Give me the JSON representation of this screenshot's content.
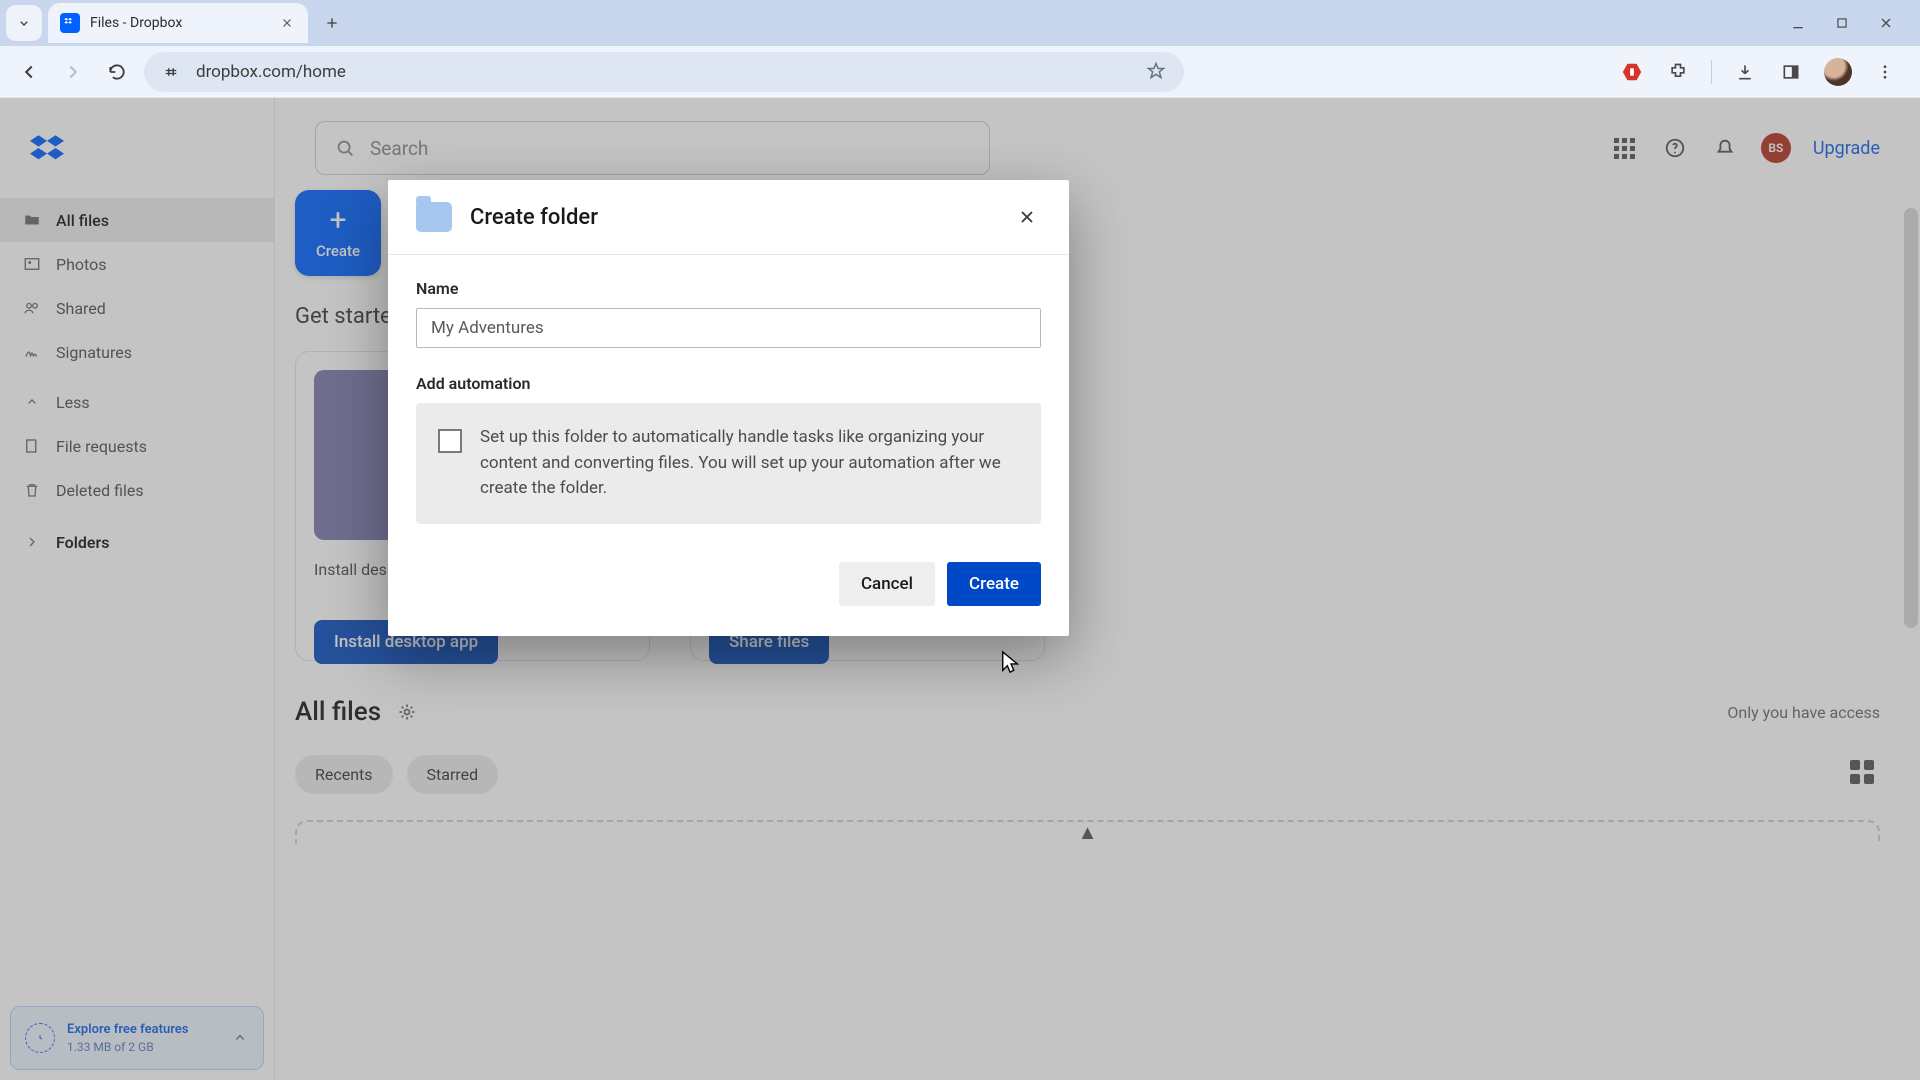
{
  "browser": {
    "tab_title": "Files - Dropbox",
    "url": "dropbox.com/home"
  },
  "sidebar": {
    "items": [
      {
        "label": "All files"
      },
      {
        "label": "Photos"
      },
      {
        "label": "Shared"
      },
      {
        "label": "Signatures"
      },
      {
        "label": "Less"
      },
      {
        "label": "File requests"
      },
      {
        "label": "Deleted files"
      }
    ],
    "folders_label": "Folders",
    "storage": {
      "line1": "Explore free features",
      "line2": "1.33 MB of 2 GB"
    }
  },
  "topbar": {
    "search_placeholder": "Search",
    "profile_initials": "BS",
    "upgrade_label": "Upgrade"
  },
  "main": {
    "create_label": "Create",
    "get_started_heading": "Get started",
    "cards": [
      {
        "desc": "Install desktop app and stay synced",
        "cta": "Install desktop app"
      },
      {
        "desc": "",
        "cta": "Share files"
      }
    ],
    "all_files_heading": "All files",
    "access_note": "Only you have access",
    "chips": [
      "Recents",
      "Starred"
    ]
  },
  "modal": {
    "title": "Create folder",
    "name_label": "Name",
    "name_value": "My Adventures",
    "automation_label": "Add automation",
    "automation_text": "Set up this folder to automatically handle tasks like organizing your content and converting files. You will set up your automation after we create the folder.",
    "cancel_label": "Cancel",
    "create_label": "Create"
  }
}
